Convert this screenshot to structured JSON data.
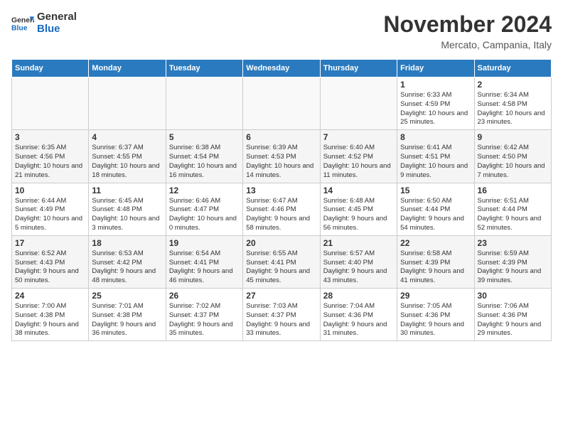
{
  "header": {
    "logo_general": "General",
    "logo_blue": "Blue",
    "month_title": "November 2024",
    "location": "Mercato, Campania, Italy"
  },
  "weekdays": [
    "Sunday",
    "Monday",
    "Tuesday",
    "Wednesday",
    "Thursday",
    "Friday",
    "Saturday"
  ],
  "weeks": [
    [
      {
        "day": "",
        "info": ""
      },
      {
        "day": "",
        "info": ""
      },
      {
        "day": "",
        "info": ""
      },
      {
        "day": "",
        "info": ""
      },
      {
        "day": "",
        "info": ""
      },
      {
        "day": "1",
        "info": "Sunrise: 6:33 AM\nSunset: 4:59 PM\nDaylight: 10 hours and 25 minutes."
      },
      {
        "day": "2",
        "info": "Sunrise: 6:34 AM\nSunset: 4:58 PM\nDaylight: 10 hours and 23 minutes."
      }
    ],
    [
      {
        "day": "3",
        "info": "Sunrise: 6:35 AM\nSunset: 4:56 PM\nDaylight: 10 hours and 21 minutes."
      },
      {
        "day": "4",
        "info": "Sunrise: 6:37 AM\nSunset: 4:55 PM\nDaylight: 10 hours and 18 minutes."
      },
      {
        "day": "5",
        "info": "Sunrise: 6:38 AM\nSunset: 4:54 PM\nDaylight: 10 hours and 16 minutes."
      },
      {
        "day": "6",
        "info": "Sunrise: 6:39 AM\nSunset: 4:53 PM\nDaylight: 10 hours and 14 minutes."
      },
      {
        "day": "7",
        "info": "Sunrise: 6:40 AM\nSunset: 4:52 PM\nDaylight: 10 hours and 11 minutes."
      },
      {
        "day": "8",
        "info": "Sunrise: 6:41 AM\nSunset: 4:51 PM\nDaylight: 10 hours and 9 minutes."
      },
      {
        "day": "9",
        "info": "Sunrise: 6:42 AM\nSunset: 4:50 PM\nDaylight: 10 hours and 7 minutes."
      }
    ],
    [
      {
        "day": "10",
        "info": "Sunrise: 6:44 AM\nSunset: 4:49 PM\nDaylight: 10 hours and 5 minutes."
      },
      {
        "day": "11",
        "info": "Sunrise: 6:45 AM\nSunset: 4:48 PM\nDaylight: 10 hours and 3 minutes."
      },
      {
        "day": "12",
        "info": "Sunrise: 6:46 AM\nSunset: 4:47 PM\nDaylight: 10 hours and 0 minutes."
      },
      {
        "day": "13",
        "info": "Sunrise: 6:47 AM\nSunset: 4:46 PM\nDaylight: 9 hours and 58 minutes."
      },
      {
        "day": "14",
        "info": "Sunrise: 6:48 AM\nSunset: 4:45 PM\nDaylight: 9 hours and 56 minutes."
      },
      {
        "day": "15",
        "info": "Sunrise: 6:50 AM\nSunset: 4:44 PM\nDaylight: 9 hours and 54 minutes."
      },
      {
        "day": "16",
        "info": "Sunrise: 6:51 AM\nSunset: 4:44 PM\nDaylight: 9 hours and 52 minutes."
      }
    ],
    [
      {
        "day": "17",
        "info": "Sunrise: 6:52 AM\nSunset: 4:43 PM\nDaylight: 9 hours and 50 minutes."
      },
      {
        "day": "18",
        "info": "Sunrise: 6:53 AM\nSunset: 4:42 PM\nDaylight: 9 hours and 48 minutes."
      },
      {
        "day": "19",
        "info": "Sunrise: 6:54 AM\nSunset: 4:41 PM\nDaylight: 9 hours and 46 minutes."
      },
      {
        "day": "20",
        "info": "Sunrise: 6:55 AM\nSunset: 4:41 PM\nDaylight: 9 hours and 45 minutes."
      },
      {
        "day": "21",
        "info": "Sunrise: 6:57 AM\nSunset: 4:40 PM\nDaylight: 9 hours and 43 minutes."
      },
      {
        "day": "22",
        "info": "Sunrise: 6:58 AM\nSunset: 4:39 PM\nDaylight: 9 hours and 41 minutes."
      },
      {
        "day": "23",
        "info": "Sunrise: 6:59 AM\nSunset: 4:39 PM\nDaylight: 9 hours and 39 minutes."
      }
    ],
    [
      {
        "day": "24",
        "info": "Sunrise: 7:00 AM\nSunset: 4:38 PM\nDaylight: 9 hours and 38 minutes."
      },
      {
        "day": "25",
        "info": "Sunrise: 7:01 AM\nSunset: 4:38 PM\nDaylight: 9 hours and 36 minutes."
      },
      {
        "day": "26",
        "info": "Sunrise: 7:02 AM\nSunset: 4:37 PM\nDaylight: 9 hours and 35 minutes."
      },
      {
        "day": "27",
        "info": "Sunrise: 7:03 AM\nSunset: 4:37 PM\nDaylight: 9 hours and 33 minutes."
      },
      {
        "day": "28",
        "info": "Sunrise: 7:04 AM\nSunset: 4:36 PM\nDaylight: 9 hours and 31 minutes."
      },
      {
        "day": "29",
        "info": "Sunrise: 7:05 AM\nSunset: 4:36 PM\nDaylight: 9 hours and 30 minutes."
      },
      {
        "day": "30",
        "info": "Sunrise: 7:06 AM\nSunset: 4:36 PM\nDaylight: 9 hours and 29 minutes."
      }
    ]
  ]
}
